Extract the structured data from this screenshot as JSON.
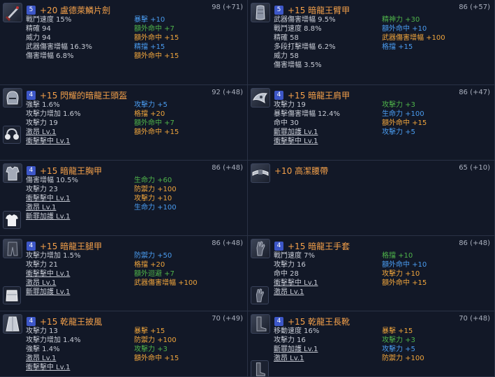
{
  "items": [
    {
      "id": "item1",
      "badge": "5",
      "name": "+20 盧德萊鱗片劍",
      "score": "98 (+71)",
      "icon": "sword-icon",
      "left": [
        "戰鬥速度 15%",
        "精確 94",
        "威力 94",
        "武器傷害增幅 16.3%",
        "傷害增幅 6.8%"
      ],
      "right": [
        {
          "t": "暴擊 +10",
          "c": "blue"
        },
        {
          "t": "額外命中 +7",
          "c": "green"
        },
        {
          "t": "額外命中 +15",
          "c": "orange"
        },
        {
          "t": "精擋 +15",
          "c": "blue"
        },
        {
          "t": "額外命中 +15",
          "c": "orange"
        }
      ]
    },
    {
      "id": "item2",
      "badge": "5",
      "name": "+15 暗龍王臂甲",
      "score": "86 (+57)",
      "icon": "bracer-icon",
      "left": [
        "武器傷害增幅 9.5%",
        "戰鬥速度 8.8%",
        "精確 58",
        "多段打擊增幅 6.2%",
        "威力 58",
        "傷害增幅 3.5%"
      ],
      "right": [
        {
          "t": "精神力 +30",
          "c": "green"
        },
        {
          "t": "額外命中 +10",
          "c": "blue"
        },
        {
          "t": "武器傷害增幅 +100",
          "c": "orange"
        },
        {
          "t": "格擋 +15",
          "c": "blue"
        }
      ]
    },
    {
      "id": "item3",
      "badge": "4",
      "name": "+15 閃耀的暗龍王頭盔",
      "score": "92 (+48)",
      "icon": "helmet-icon",
      "subicon": "earmuffs-icon",
      "left": [
        "強擊 1.6%",
        "攻擊力增加 1.6%",
        "攻擊力 19",
        "激昂 Lv.1",
        "衝擊擊中 Lv.1"
      ],
      "leftSkills": [
        3,
        4
      ],
      "right": [
        {
          "t": "攻擊力 +5",
          "c": "blue"
        },
        {
          "t": "格擋 +20",
          "c": "orange"
        },
        {
          "t": "額外命中 +7",
          "c": "green"
        },
        {
          "t": "額外命中 +15",
          "c": "orange"
        }
      ]
    },
    {
      "id": "item4",
      "badge": "4",
      "name": "+15 暗龍王肩甲",
      "score": "86 (+47)",
      "icon": "shoulder-icon",
      "left": [
        "攻擊力 19",
        "暴擊傷害增幅 12.4%",
        "命中 30",
        "斷罪加護 Lv.1",
        "衝擊擊中 Lv.1"
      ],
      "leftSkills": [
        3,
        4
      ],
      "right": [
        {
          "t": "攻擊力 +3",
          "c": "green"
        },
        {
          "t": "生命力 +100",
          "c": "blue"
        },
        {
          "t": "額外命中 +15",
          "c": "orange"
        },
        {
          "t": "攻擊力 +5",
          "c": "blue"
        }
      ]
    },
    {
      "id": "item5",
      "badge": "4",
      "name": "+15 暗龍王胸甲",
      "score": "86 (+48)",
      "icon": "chest-icon",
      "subicon": "shirt-icon",
      "left": [
        "傷害增幅 10.5%",
        "攻擊力 23",
        "衝擊擊中 Lv.1",
        "激昂 Lv.1",
        "斷罪加護 Lv.1"
      ],
      "leftSkills": [
        2,
        3,
        4
      ],
      "right": [
        {
          "t": "生命力 +60",
          "c": "green"
        },
        {
          "t": "防禦力 +100",
          "c": "orange"
        },
        {
          "t": "攻擊力 +10",
          "c": "orange"
        },
        {
          "t": "生命力 +100",
          "c": "blue"
        }
      ]
    },
    {
      "id": "item6",
      "badge": "",
      "name": "+10 高潔腰帶",
      "score": "65 (+10)",
      "icon": "belt-icon",
      "left": [],
      "right": []
    },
    {
      "id": "item7",
      "badge": "4",
      "name": "+15 暗龍王腿甲",
      "score": "86 (+48)",
      "icon": "pants-icon",
      "subicon": "armor-icon",
      "left": [
        "攻擊力增加 1.5%",
        "攻擊力 21",
        "衝擊擊中 Lv.1",
        "激昂 Lv.1",
        "斷罪加護 Lv.1"
      ],
      "leftSkills": [
        2,
        3,
        4
      ],
      "right": [
        {
          "t": "防禦力 +50",
          "c": "blue"
        },
        {
          "t": "格擋 +20",
          "c": "orange"
        },
        {
          "t": "額外迴避 +7",
          "c": "green"
        },
        {
          "t": "武器傷害增幅 +100",
          "c": "orange"
        }
      ]
    },
    {
      "id": "item8",
      "badge": "4",
      "name": "+15 暗龍王手套",
      "score": "86 (+48)",
      "icon": "glove-icon",
      "subicon": "glove-icon",
      "left": [
        "戰鬥速度 7%",
        "攻擊力 16",
        "命中 28",
        "衝擊擊中 Lv.1",
        "激昂 Lv.1"
      ],
      "leftSkills": [
        3,
        4
      ],
      "right": [
        {
          "t": "格擋 +10",
          "c": "green"
        },
        {
          "t": "額外命中 +10",
          "c": "blue"
        },
        {
          "t": "攻擊力 +10",
          "c": "orange"
        },
        {
          "t": "額外命中 +15",
          "c": "orange"
        }
      ]
    },
    {
      "id": "item9",
      "badge": "4",
      "name": "+15 乾龍王披風",
      "score": "70 (+49)",
      "icon": "cape-icon",
      "left": [
        "攻擊力 13",
        "攻擊力增加 1.4%",
        "強擊 1.4%",
        "激昂 Lv.1",
        "衝擊擊中 Lv.1"
      ],
      "leftSkills": [
        3,
        4
      ],
      "right": [
        {
          "t": "暴擊 +15",
          "c": "orange"
        },
        {
          "t": "防禦力 +100",
          "c": "orange"
        },
        {
          "t": "攻擊力 +3",
          "c": "green"
        },
        {
          "t": "額外命中 +15",
          "c": "orange"
        }
      ]
    },
    {
      "id": "item10",
      "badge": "4",
      "name": "+15 乾龍王長靴",
      "score": "70 (+48)",
      "icon": "boots-icon",
      "subicon": "boots-icon",
      "left": [
        "移動速度 16%",
        "攻擊力 16",
        "斷罪加護 Lv.1",
        "激昂 Lv.1"
      ],
      "leftSkills": [
        2,
        3
      ],
      "right": [
        {
          "t": "暴擊 +15",
          "c": "orange"
        },
        {
          "t": "攻擊力 +3",
          "c": "green"
        },
        {
          "t": "攻擊力 +5",
          "c": "blue"
        },
        {
          "t": "防禦力 +100",
          "c": "orange"
        }
      ]
    }
  ]
}
